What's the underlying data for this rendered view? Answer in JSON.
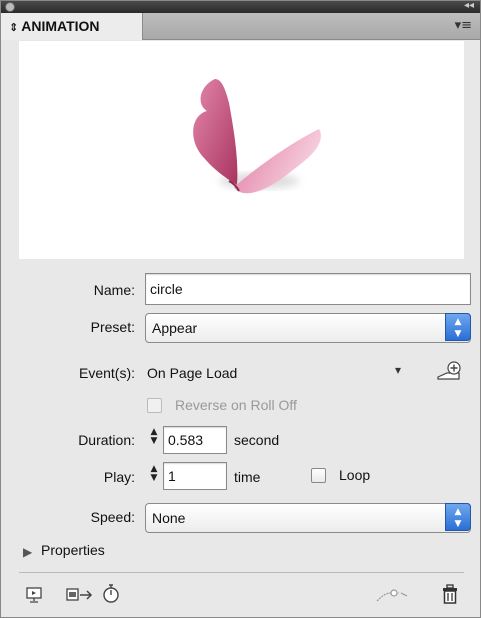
{
  "panel": {
    "tab_title": "ANIMATION",
    "tab_arrows": "⬍",
    "collapse_glyph": "◂◂",
    "menu_glyph": "▾≡"
  },
  "preview": {
    "subject": "butterfly",
    "colors": {
      "wing_dark": "#c2517f",
      "wing_light": "#f0b6cb",
      "shadow": "#999999"
    }
  },
  "form": {
    "name_label": "Name:",
    "name_value": "circle",
    "preset_label": "Preset:",
    "preset_value": "Appear",
    "events_label": "Event(s):",
    "events_value": "On Page Load",
    "events_dropdown_glyph": "▾",
    "reverse_label": "Reverse on Roll Off",
    "reverse_checked": false,
    "duration_label": "Duration:",
    "duration_value": "0.583",
    "duration_unit": "second",
    "play_label": "Play:",
    "play_value": "1",
    "play_unit": "time",
    "loop_label": "Loop",
    "loop_checked": false,
    "speed_label": "Speed:",
    "speed_value": "None"
  },
  "properties": {
    "label": "Properties",
    "disclosure_glyph": "▶"
  },
  "footer_icons": [
    "preview-panel-icon",
    "convert-to-motion-path-icon",
    "timing-icon",
    "motion-path-icon",
    "delete-icon"
  ],
  "stepper_glyph": "▲\n▼"
}
